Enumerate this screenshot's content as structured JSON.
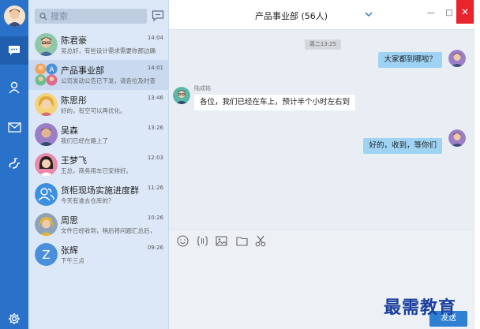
{
  "window": {
    "minimize": "—",
    "maximize": "□",
    "close": "✕"
  },
  "search": {
    "placeholder": "搜索"
  },
  "chat": {
    "title": "产品事业部 (56人)",
    "timestamp": "周二13:25",
    "send_label": "发送"
  },
  "conversations": [
    {
      "name": "陈君豪",
      "time": "14:04",
      "preview": "吴总好，有些设计需求需要你那边确",
      "avatar": "man-glasses"
    },
    {
      "name": "产品事业部",
      "time": "14:01",
      "preview": "公司发动公告已下发，请各位及时查",
      "avatar": "group"
    },
    {
      "name": "陈思彤",
      "time": "13:46",
      "preview": "好的，有空可以再优化。",
      "avatar": "woman-blonde"
    },
    {
      "name": "吴森",
      "time": "13:26",
      "preview": "我们已经在路上了",
      "avatar": "man-dark"
    },
    {
      "name": "王梦飞",
      "time": "12:03",
      "preview": "王总，商务用车已安排好。",
      "avatar": "woman-dark"
    },
    {
      "name": "货柜现场实施进度群",
      "time": "11:26",
      "preview": "今天有谁去仓库的？",
      "avatar": "group-blue"
    },
    {
      "name": "周思",
      "time": "10:26",
      "preview": "文件已经收到，稍后将问题汇总后，",
      "avatar": "man-gold"
    },
    {
      "name": "张辉",
      "time": "09:26",
      "preview": "下午三点",
      "avatar": "letter-Z"
    }
  ],
  "messages": [
    {
      "direction": "out",
      "text": "大家都到哪啦？"
    },
    {
      "direction": "in",
      "sender": "陆成铭",
      "text": "各位，我们已经在车上，预计半个小时左右到"
    },
    {
      "direction": "out",
      "text": "好的，收到，等你们"
    }
  ],
  "toolbar_icons": [
    "emoji-icon",
    "code-icon",
    "image-icon",
    "folder-icon",
    "scissors-icon"
  ],
  "watermark": "最需教育",
  "colors": {
    "rail": "#2a72c9",
    "list_bg": "#dce8f8",
    "bubble_out": "#9fd3f4",
    "send": "#2f7fd3",
    "close": "#e8242c"
  }
}
